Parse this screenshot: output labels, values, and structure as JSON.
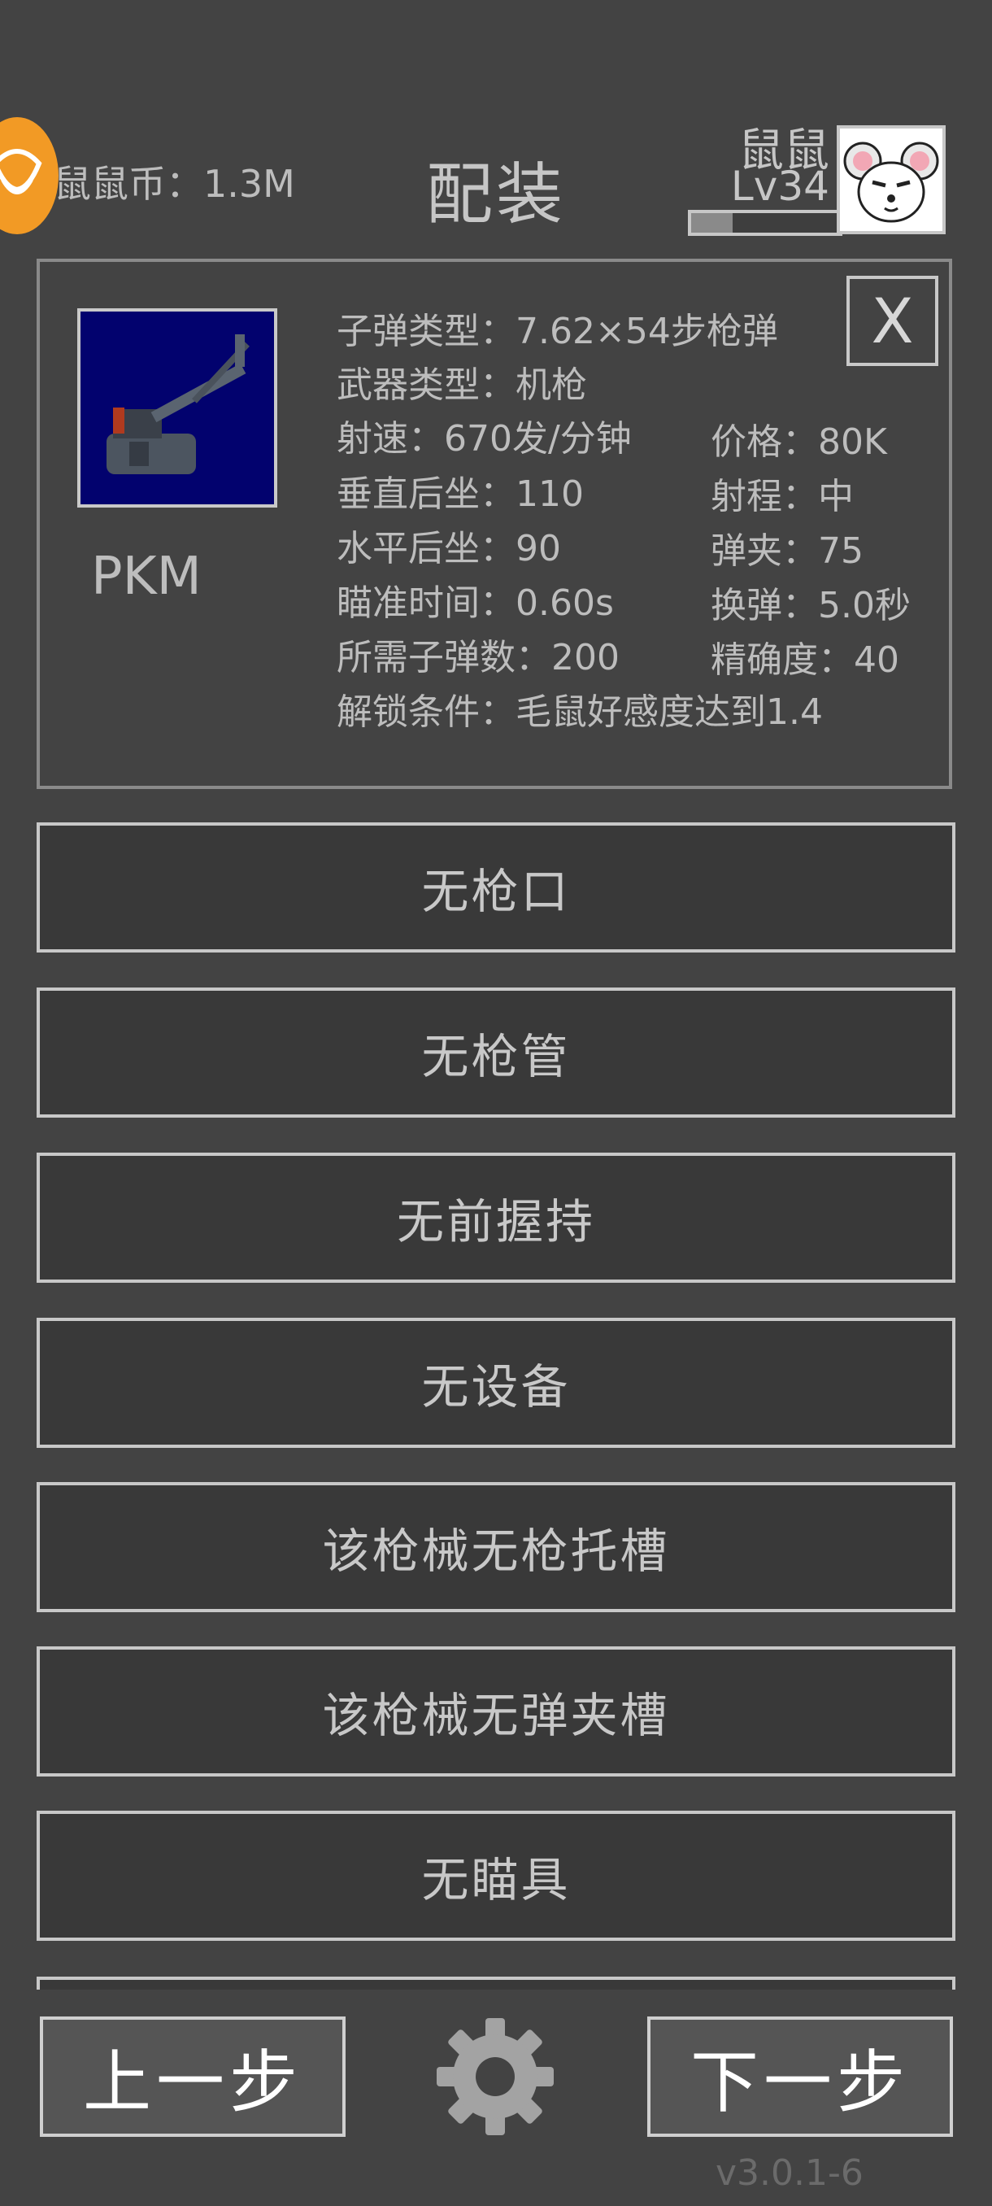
{
  "header": {
    "coin_text": "鼠鼠币：1.3M",
    "title": "配装",
    "player_name": "鼠鼠",
    "player_level": "Lv34",
    "xp_progress": 0.28
  },
  "weapon": {
    "name": "PKM",
    "close_label": "X",
    "stats_left": [
      "子弹类型：7.62×54步枪弹",
      "武器类型：机枪",
      "射速：670发/分钟",
      "垂直后坐：110",
      "水平后坐：90",
      "瞄准时间：0.60s",
      "所需子弹数：200",
      "解锁条件：毛鼠好感度达到1.4"
    ],
    "stats_right": [
      "价格：80K",
      "射程：中",
      "弹夹：75",
      "换弹：5.0秒",
      "精确度：40"
    ]
  },
  "slots": [
    "无枪口",
    "无枪管",
    "无前握持",
    "无设备",
    "该枪械无枪托槽",
    "该枪械无弹夹槽",
    "无瞄具"
  ],
  "footer": {
    "prev_label": "上一步",
    "next_label": "下一步",
    "settings_icon": "gear-icon",
    "version": "v3.0.1-6"
  },
  "colors": {
    "background": "#434343",
    "coin": "#f29a25",
    "weapon_bg": "#02026e"
  }
}
